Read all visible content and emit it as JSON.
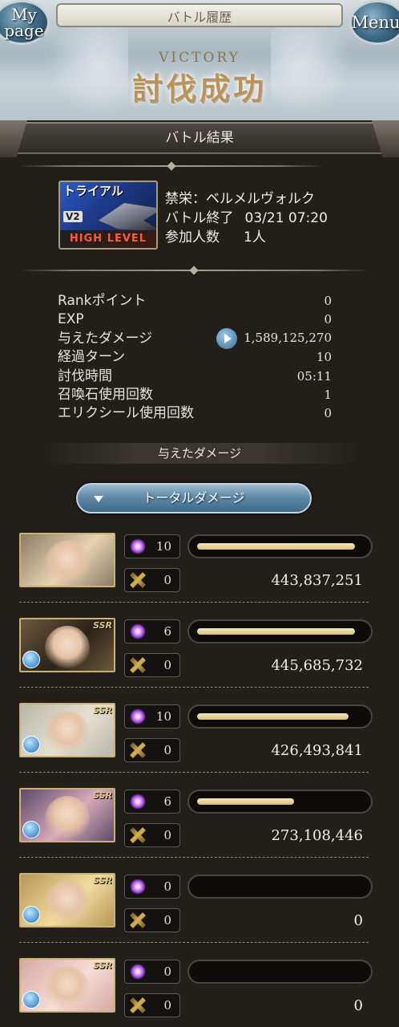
{
  "header": {
    "history_title": "バトル履歴",
    "mypage_label_1": "My",
    "mypage_label_2": "page",
    "menu_label": "Menu",
    "victory": "VICTORY",
    "result_title": "討伐成功"
  },
  "section": {
    "title": "バトル結果"
  },
  "quest": {
    "thumb_tag": "トライアル",
    "thumb_version": "V2",
    "thumb_level": "HIGH LEVEL",
    "name": "禁栄：ベルメルヴォルク",
    "end_label": "バトル終了",
    "end_value": "03/21 07:20",
    "participants_label": "参加人数",
    "participants_value": "1人"
  },
  "stats": [
    {
      "label": "Rankポイント",
      "value": "0"
    },
    {
      "label": "EXP",
      "value": "0"
    },
    {
      "label": "与えたダメージ",
      "value": "1,589,125,270"
    },
    {
      "label": "経過ターン",
      "value": "10"
    },
    {
      "label": "討伐時間",
      "value": "05:11"
    },
    {
      "label": "召喚石使用回数",
      "value": "1"
    },
    {
      "label": "エリクシール使用回数",
      "value": "0"
    }
  ],
  "damage_section": {
    "title": "与えたダメージ",
    "toggle_label": "トータルダメージ"
  },
  "characters": [
    {
      "rarity": "",
      "element_icon": "",
      "hits": "10",
      "specials": "0",
      "damage": "443,837,251",
      "bar_fraction": 0.96,
      "palette": [
        "#8b7a63",
        "#e8d3b2"
      ]
    },
    {
      "rarity": "SSR",
      "element_icon": "water-icon",
      "hits": "6",
      "specials": "0",
      "damage": "445,685,732",
      "bar_fraction": 0.96,
      "palette": [
        "#6b5a3c",
        "#2a2218"
      ]
    },
    {
      "rarity": "SSR",
      "element_icon": "water-icon",
      "hits": "10",
      "specials": "0",
      "damage": "426,493,841",
      "bar_fraction": 0.92,
      "palette": [
        "#b9b6aa",
        "#e6e0d2"
      ]
    },
    {
      "rarity": "SSR",
      "element_icon": "water-icon",
      "hits": "6",
      "specials": "0",
      "damage": "273,108,446",
      "bar_fraction": 0.59,
      "palette": [
        "#5b4a6a",
        "#d8a9b8"
      ]
    },
    {
      "rarity": "SSR",
      "element_icon": "water-icon",
      "hits": "0",
      "specials": "0",
      "damage": "0",
      "bar_fraction": 0,
      "palette": [
        "#b89656",
        "#f1dca0"
      ]
    },
    {
      "rarity": "SSR",
      "element_icon": "water-icon",
      "hits": "0",
      "specials": "0",
      "damage": "0",
      "bar_fraction": 0,
      "palette": [
        "#d6a9a0",
        "#f6ddd6"
      ]
    }
  ]
}
